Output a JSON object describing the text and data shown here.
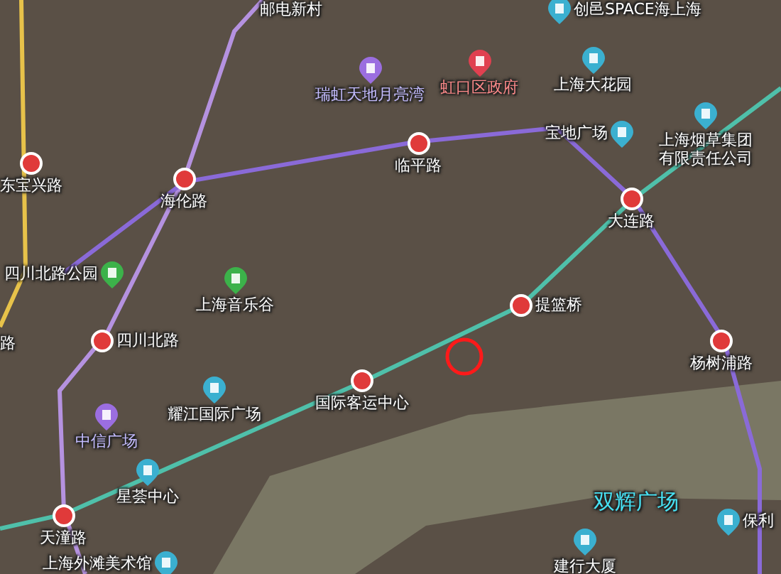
{
  "places": [
    {
      "name": "邮电新村",
      "kind": "plain"
    },
    {
      "name": "创邑SPACE海上海",
      "kind": "building"
    },
    {
      "name": "瑞虹天地月亮湾",
      "kind": "shopping"
    },
    {
      "name": "虹口区政府",
      "kind": "government"
    },
    {
      "name": "上海大花园",
      "kind": "building"
    },
    {
      "name": "东宝兴路",
      "kind": "metro"
    },
    {
      "name": "海伦路",
      "kind": "metro"
    },
    {
      "name": "临平路",
      "kind": "metro"
    },
    {
      "name": "宝地广场",
      "kind": "building"
    },
    {
      "name": "上海烟草集团有限责任公司",
      "kind": "building"
    },
    {
      "name": "大连路",
      "kind": "metro"
    },
    {
      "name": "四川北路公园",
      "kind": "park"
    },
    {
      "name": "上海音乐谷",
      "kind": "park"
    },
    {
      "name": "四川北路",
      "kind": "metro"
    },
    {
      "name": "提篮桥",
      "kind": "metro"
    },
    {
      "name": "杨树浦路",
      "kind": "metro"
    },
    {
      "name": "路",
      "kind": "plain"
    },
    {
      "name": "耀江国际广场",
      "kind": "building"
    },
    {
      "name": "国际客运中心",
      "kind": "metro"
    },
    {
      "name": "中信广场",
      "kind": "shopping"
    },
    {
      "name": "星荟中心",
      "kind": "building"
    },
    {
      "name": "天潼路",
      "kind": "metro"
    },
    {
      "name": "双辉广场",
      "kind": "district"
    },
    {
      "name": "保利",
      "kind": "building"
    },
    {
      "name": "建行大厦",
      "kind": "building"
    },
    {
      "name": "上海外滩美术馆",
      "kind": "building"
    }
  ]
}
